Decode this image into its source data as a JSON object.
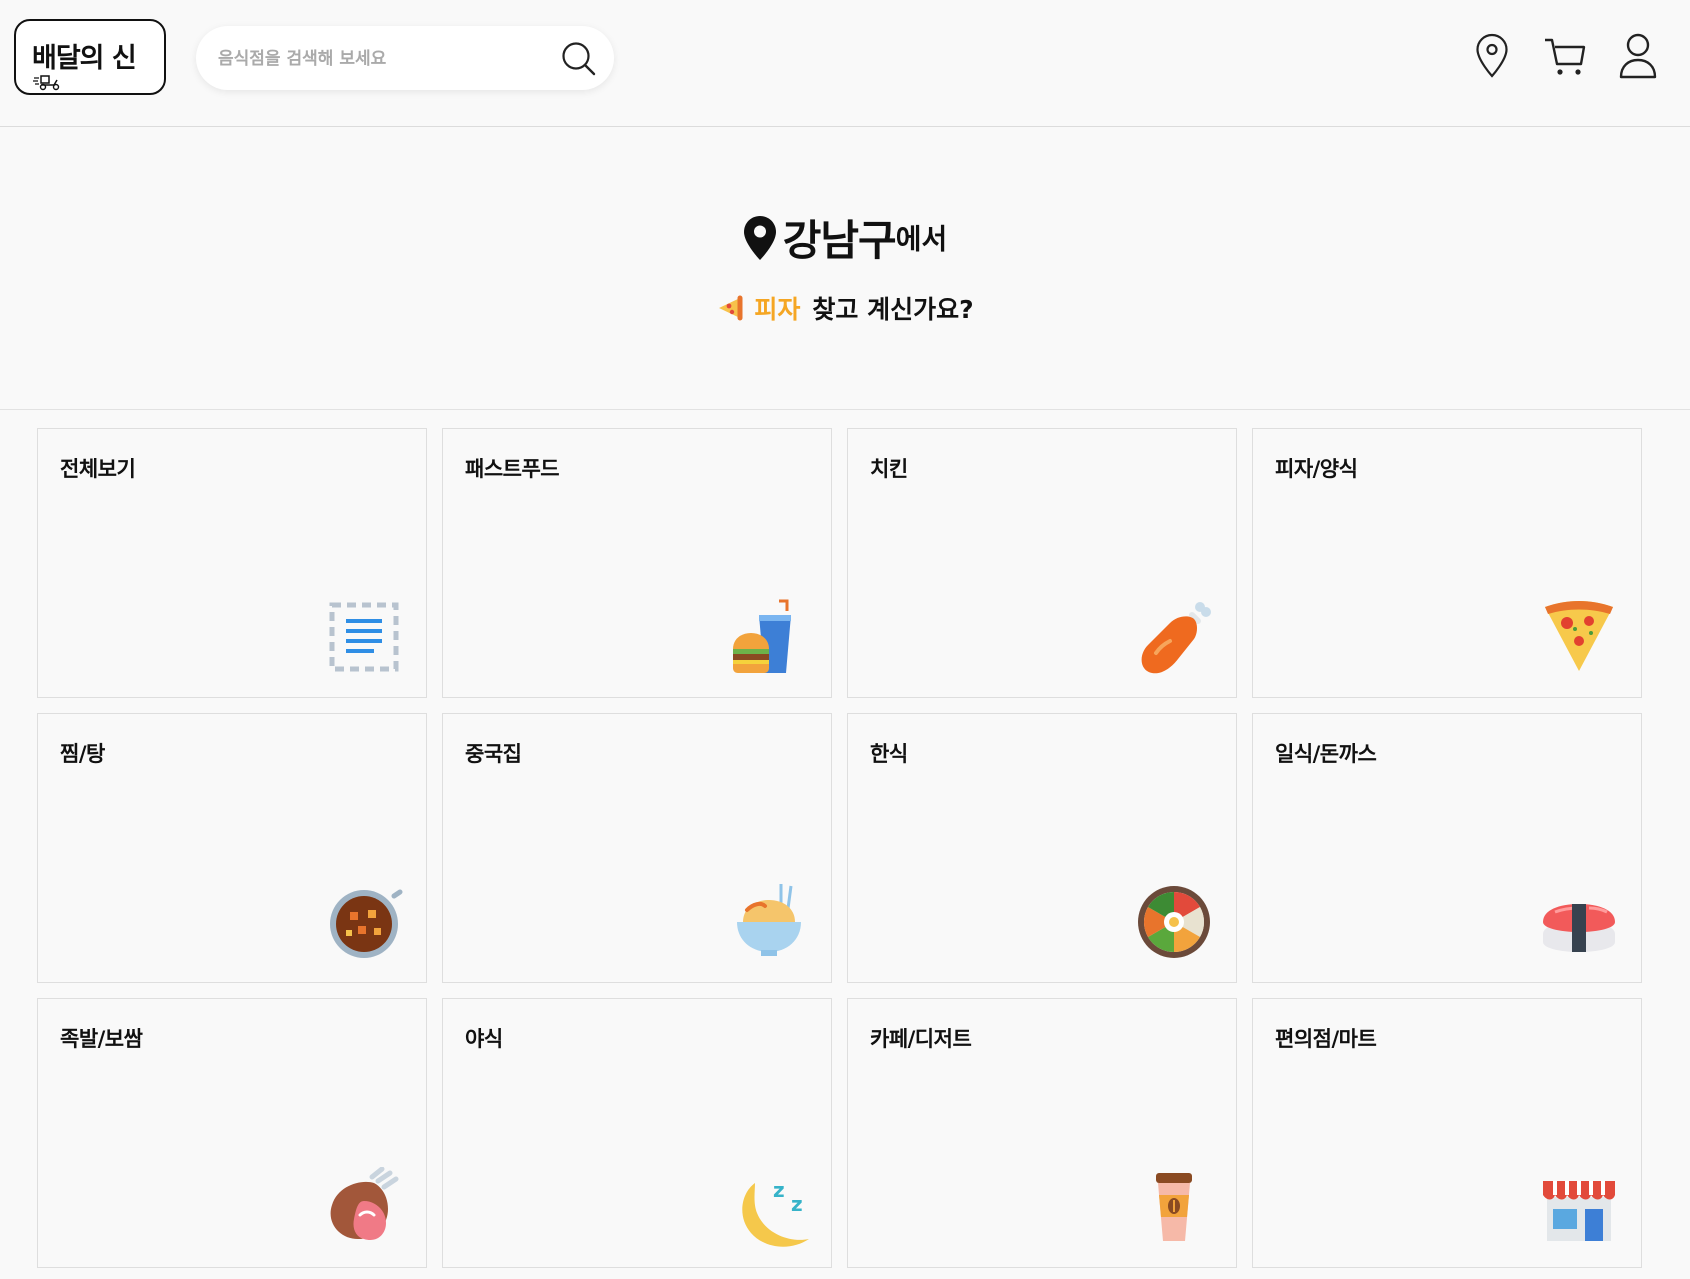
{
  "header": {
    "logo_text": "배달의 신",
    "search_placeholder": "음식점을 검색해 보세요"
  },
  "hero": {
    "location": "강남구",
    "location_suffix": "에서",
    "keyword": "피자",
    "question": "찾고 계신가요?",
    "accent_color": "#f5a623"
  },
  "categories": [
    {
      "label": "전체보기",
      "icon": "list-icon"
    },
    {
      "label": "패스트푸드",
      "icon": "burger-drink-icon"
    },
    {
      "label": "치킨",
      "icon": "chicken-leg-icon"
    },
    {
      "label": "피자/양식",
      "icon": "pizza-icon"
    },
    {
      "label": "찜/탕",
      "icon": "stew-pot-icon"
    },
    {
      "label": "중국집",
      "icon": "noodle-bowl-icon"
    },
    {
      "label": "한식",
      "icon": "bibimbap-icon"
    },
    {
      "label": "일식/돈까스",
      "icon": "sushi-icon"
    },
    {
      "label": "족발/보쌈",
      "icon": "pork-hock-icon"
    },
    {
      "label": "야식",
      "icon": "moon-sleep-icon"
    },
    {
      "label": "카페/디저트",
      "icon": "coffee-cup-icon"
    },
    {
      "label": "편의점/마트",
      "icon": "store-icon"
    }
  ]
}
